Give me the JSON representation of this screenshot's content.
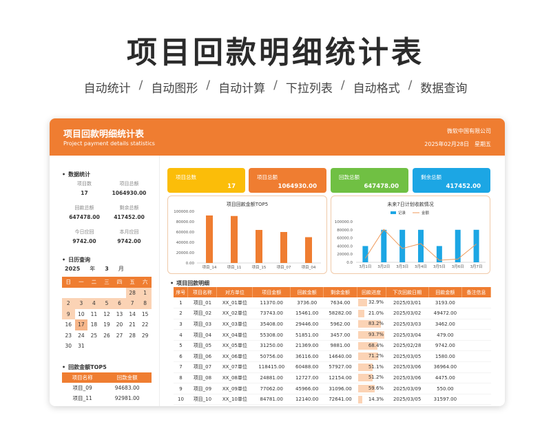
{
  "hero": {
    "title": "项目回款明细统计表",
    "features": [
      "自动统计",
      "自动图形",
      "自动计算",
      "下拉列表",
      "自动格式",
      "数据查询"
    ],
    "sep": "/"
  },
  "header": {
    "title": "项目回款明细统计表",
    "subtitle": "Project payment details statistics",
    "company": "微软中国有限公司",
    "date": "2025年02月28日",
    "weekday": "星期五"
  },
  "stats": {
    "section": "数据统计",
    "rows": [
      [
        {
          "label": "项目数",
          "value": "17"
        },
        {
          "label": "项目总额",
          "value": "1064930.00"
        }
      ],
      [
        {
          "label": "回款总额",
          "value": "647478.00"
        },
        {
          "label": "剩余总额",
          "value": "417452.00"
        }
      ],
      [
        {
          "label": "今日应回",
          "value": "9742.00"
        },
        {
          "label": "本月应回",
          "value": "9742.00"
        }
      ]
    ]
  },
  "calendar": {
    "section": "日历查询",
    "year": "2025",
    "year_unit": "年",
    "month": "3",
    "month_unit": "月",
    "weekdays": [
      "日",
      "一",
      "二",
      "三",
      "四",
      "五",
      "六"
    ],
    "weeks": [
      [
        "",
        "",
        "",
        "",
        "",
        "28",
        "1"
      ],
      [
        "2",
        "3",
        "4",
        "5",
        "6",
        "7",
        "8"
      ],
      [
        "9",
        "10",
        "11",
        "12",
        "13",
        "14",
        "15"
      ],
      [
        "16",
        "17",
        "18",
        "19",
        "20",
        "21",
        "22"
      ],
      [
        "23",
        "24",
        "25",
        "26",
        "27",
        "28",
        "29"
      ],
      [
        "30",
        "31",
        "",
        "",
        "",
        "",
        ""
      ]
    ]
  },
  "top5": {
    "section": "回款金额TOP5",
    "headers": [
      "项目名称",
      "回款金额"
    ],
    "rows": [
      [
        "项目_09",
        "94683.00"
      ],
      [
        "项目_11",
        "92981.00"
      ]
    ]
  },
  "kpis": [
    {
      "label": "项目总数",
      "value": "17",
      "color": "#fbbd09"
    },
    {
      "label": "项目总额",
      "value": "1064930.00",
      "color": "#ef7d31"
    },
    {
      "label": "回款总额",
      "value": "647478.00",
      "color": "#70c043"
    },
    {
      "label": "剩余总额",
      "value": "417452.00",
      "color": "#1ca6e4"
    }
  ],
  "chart_data": [
    {
      "type": "bar",
      "title": "项目回款金额TOP5",
      "categories": [
        "项目_14",
        "项目_11",
        "项目_15",
        "项目_07",
        "项目_04"
      ],
      "values": [
        92000,
        91000,
        64000,
        60000,
        50000
      ],
      "ylim": [
        0,
        100000
      ],
      "yticks": [
        "100000.00",
        "80000.00",
        "60000.00",
        "40000.00",
        "20000.00",
        "0.00"
      ],
      "color": "#ef7d31"
    },
    {
      "type": "bar+line",
      "title": "未来7日计划收款情况",
      "categories": [
        "3月1日",
        "3月2日",
        "3月3日",
        "3月4日",
        "3月5日",
        "3月6日",
        "3月7日"
      ],
      "series": [
        {
          "name": "记录",
          "type": "bar",
          "values": [
            40000,
            80000,
            80000,
            80000,
            40000,
            80000,
            80000
          ],
          "color": "#1ca6e4"
        },
        {
          "name": "金额",
          "type": "line",
          "values": [
            9742,
            81000,
            34000,
            46000,
            5000,
            7800,
            45000
          ],
          "color": "#ef9a5a"
        }
      ],
      "ylim": [
        0,
        100000
      ],
      "yticks": [
        "100000.0",
        "80000.0",
        "60000.0",
        "40000.0",
        "20000.0",
        "0.0"
      ],
      "legend": "top"
    }
  ],
  "detail": {
    "section": "项目回款明细",
    "headers": [
      "序号",
      "项目名称",
      "对方单位",
      "项目金额",
      "回款金额",
      "剩余金额",
      "回款进度",
      "下次回款日期",
      "回款金额",
      "备注信息"
    ],
    "rows": [
      {
        "no": "1",
        "name": "项目_01",
        "unit": "XX_01单位",
        "amount": "11370.00",
        "paid": "3736.00",
        "remain": "7634.00",
        "progress": "32.9%",
        "pct": 32.9,
        "next": "2025/03/01",
        "next_amt": "3193.00",
        "note": ""
      },
      {
        "no": "2",
        "name": "项目_02",
        "unit": "XX_02单位",
        "amount": "73743.00",
        "paid": "15461.00",
        "remain": "58282.00",
        "progress": "21.0%",
        "pct": 21.0,
        "next": "2025/03/02",
        "next_amt": "49472.00",
        "note": ""
      },
      {
        "no": "3",
        "name": "项目_03",
        "unit": "XX_03单位",
        "amount": "35408.00",
        "paid": "29446.00",
        "remain": "5962.00",
        "progress": "83.2%",
        "pct": 83.2,
        "next": "2025/03/03",
        "next_amt": "3462.00",
        "note": ""
      },
      {
        "no": "4",
        "name": "项目_04",
        "unit": "XX_04单位",
        "amount": "55308.00",
        "paid": "51851.00",
        "remain": "3457.00",
        "progress": "93.7%",
        "pct": 93.7,
        "next": "2025/03/04",
        "next_amt": "479.00",
        "note": ""
      },
      {
        "no": "5",
        "name": "项目_05",
        "unit": "XX_05单位",
        "amount": "31250.00",
        "paid": "21369.00",
        "remain": "9881.00",
        "progress": "68.4%",
        "pct": 68.4,
        "next": "2025/02/28",
        "next_amt": "9742.00",
        "note": ""
      },
      {
        "no": "6",
        "name": "项目_06",
        "unit": "XX_06单位",
        "amount": "50756.00",
        "paid": "36116.00",
        "remain": "14640.00",
        "progress": "71.2%",
        "pct": 71.2,
        "next": "2025/03/05",
        "next_amt": "1580.00",
        "note": ""
      },
      {
        "no": "7",
        "name": "项目_07",
        "unit": "XX_07单位",
        "amount": "118415.00",
        "paid": "60488.00",
        "remain": "57927.00",
        "progress": "51.1%",
        "pct": 51.1,
        "next": "2025/03/06",
        "next_amt": "36964.00",
        "note": ""
      },
      {
        "no": "8",
        "name": "项目_08",
        "unit": "XX_08单位",
        "amount": "24881.00",
        "paid": "12727.00",
        "remain": "12154.00",
        "progress": "51.2%",
        "pct": 51.2,
        "next": "2025/03/06",
        "next_amt": "4475.00",
        "note": ""
      },
      {
        "no": "9",
        "name": "项目_09",
        "unit": "XX_09单位",
        "amount": "77062.00",
        "paid": "45966.00",
        "remain": "31096.00",
        "progress": "59.6%",
        "pct": 59.6,
        "next": "2025/03/09",
        "next_amt": "550.00",
        "note": ""
      },
      {
        "no": "10",
        "name": "项目_10",
        "unit": "XX_10单位",
        "amount": "84781.00",
        "paid": "12140.00",
        "remain": "72641.00",
        "progress": "14.3%",
        "pct": 14.3,
        "next": "2025/03/05",
        "next_amt": "31597.00",
        "note": ""
      }
    ]
  }
}
